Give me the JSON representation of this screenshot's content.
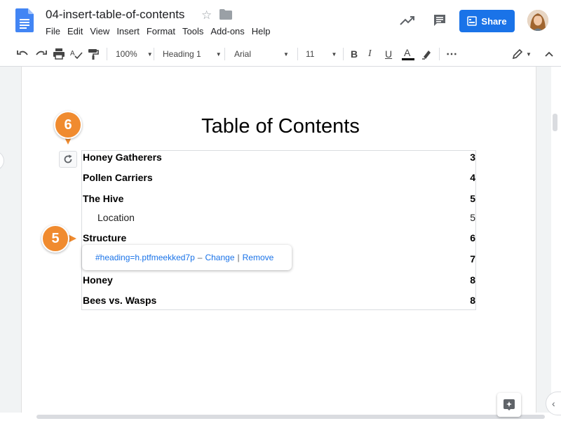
{
  "header": {
    "doc_title": "04-insert-table-of-contents",
    "menu": [
      "File",
      "Edit",
      "View",
      "Insert",
      "Format",
      "Tools",
      "Add-ons",
      "Help"
    ],
    "share_label": "Share",
    "brand_color": "#1a73e8"
  },
  "toolbar": {
    "zoom": "100%",
    "style": "Heading 1",
    "font": "Arial",
    "font_size": "11",
    "more": "⋯"
  },
  "document": {
    "toc_title": "Table of Contents",
    "entries": [
      {
        "text": "Honey Gatherers",
        "page": "3",
        "level": 1
      },
      {
        "text": "Pollen Carriers",
        "page": "4",
        "level": 1
      },
      {
        "text": "The Hive",
        "page": "5",
        "level": 1
      },
      {
        "text": "Location",
        "page": "5",
        "level": 2
      },
      {
        "text": "Structure",
        "page": "6",
        "level": 1
      },
      {
        "text": "",
        "page": "7",
        "level": 1
      },
      {
        "text": "Honey",
        "page": "8",
        "level": 1
      },
      {
        "text": "Bees vs. Wasps",
        "page": "8",
        "level": 1
      }
    ],
    "link_popup": {
      "url": "#heading=h.ptfmeekked7p",
      "dash": "–",
      "change": "Change",
      "separator": "|",
      "remove": "Remove"
    }
  },
  "callouts": {
    "step6": "6",
    "step5": "5",
    "color": "#f08b2f"
  }
}
